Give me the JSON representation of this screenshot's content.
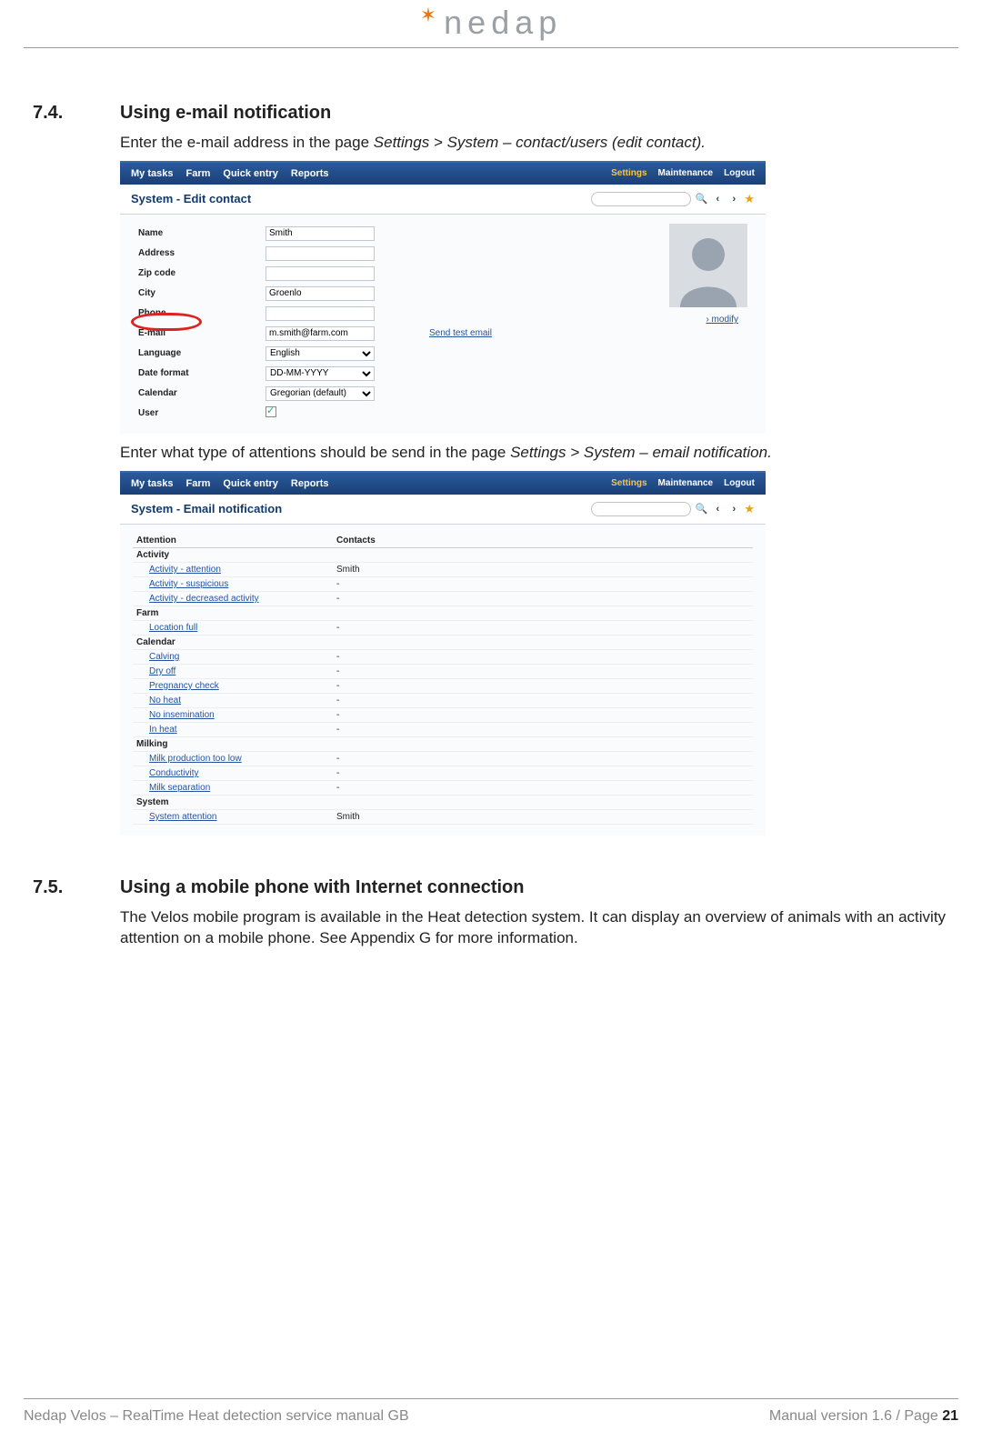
{
  "brand": {
    "name": "nedap"
  },
  "sections": {
    "s74": {
      "num": "7.4.",
      "title": "Using e-mail notification",
      "intro_plain": "Enter the e-mail address in the page ",
      "intro_italic": "Settings > System – contact/users (edit contact).",
      "mid_plain": "Enter what type of attentions should be send in the page ",
      "mid_italic": "Settings > System – email notification.",
      "mid_end": "."
    },
    "s75": {
      "num": "7.5.",
      "title": "Using a mobile phone with Internet connection",
      "body": "The Velos mobile program is available in the Heat detection system. It can display an overview of animals with an activity attention on a mobile phone. See Appendix G for more information."
    }
  },
  "app_menu": {
    "left": [
      "My tasks",
      "Farm",
      "Quick entry",
      "Reports"
    ],
    "right": [
      "Settings",
      "Maintenance",
      "Logout"
    ]
  },
  "screenshot1": {
    "subtitle": "System - Edit contact",
    "send_test": "Send test email",
    "modify": "modify",
    "rows": [
      {
        "label": "Name",
        "type": "text",
        "value": "Smith"
      },
      {
        "label": "Address",
        "type": "text",
        "value": ""
      },
      {
        "label": "Zip code",
        "type": "text",
        "value": ""
      },
      {
        "label": "City",
        "type": "text",
        "value": "Groenlo"
      },
      {
        "label": "Phone",
        "type": "text",
        "value": ""
      },
      {
        "label": "E-mail",
        "type": "text",
        "value": "m.smith@farm.com",
        "extra": "send_test"
      },
      {
        "label": "Language",
        "type": "select",
        "value": "English"
      },
      {
        "label": "Date format",
        "type": "select",
        "value": "DD-MM-YYYY"
      },
      {
        "label": "Calendar",
        "type": "select",
        "value": "Gregorian (default)"
      },
      {
        "label": "User",
        "type": "check",
        "value": "checked"
      }
    ]
  },
  "screenshot2": {
    "subtitle": "System - Email notification",
    "headers": [
      "Attention",
      "Contacts"
    ],
    "rows": [
      {
        "c1": "Activity",
        "c2": "",
        "kind": "cat"
      },
      {
        "c1": "Activity - attention",
        "c2": "Smith",
        "kind": "link"
      },
      {
        "c1": "Activity - suspicious",
        "c2": "-",
        "kind": "link"
      },
      {
        "c1": "Activity - decreased activity",
        "c2": "-",
        "kind": "link"
      },
      {
        "c1": "Farm",
        "c2": "",
        "kind": "cat"
      },
      {
        "c1": "Location full",
        "c2": "-",
        "kind": "link"
      },
      {
        "c1": "Calendar",
        "c2": "",
        "kind": "cat"
      },
      {
        "c1": "Calving",
        "c2": "-",
        "kind": "link"
      },
      {
        "c1": "Dry off",
        "c2": "-",
        "kind": "link"
      },
      {
        "c1": "Pregnancy check",
        "c2": "-",
        "kind": "link"
      },
      {
        "c1": "No heat",
        "c2": "-",
        "kind": "link"
      },
      {
        "c1": "No insemination",
        "c2": "-",
        "kind": "link"
      },
      {
        "c1": "In heat",
        "c2": "-",
        "kind": "link"
      },
      {
        "c1": "Milking",
        "c2": "",
        "kind": "cat"
      },
      {
        "c1": "Milk production too low",
        "c2": "-",
        "kind": "link"
      },
      {
        "c1": "Conductivity",
        "c2": "-",
        "kind": "link"
      },
      {
        "c1": "Milk separation",
        "c2": "-",
        "kind": "link"
      },
      {
        "c1": "System",
        "c2": "",
        "kind": "cat"
      },
      {
        "c1": "System attention",
        "c2": "Smith",
        "kind": "link"
      }
    ]
  },
  "footer": {
    "left": "Nedap Velos – RealTime Heat detection service manual GB",
    "right_prefix": "Manual version 1.6 / Page ",
    "page": "21"
  }
}
